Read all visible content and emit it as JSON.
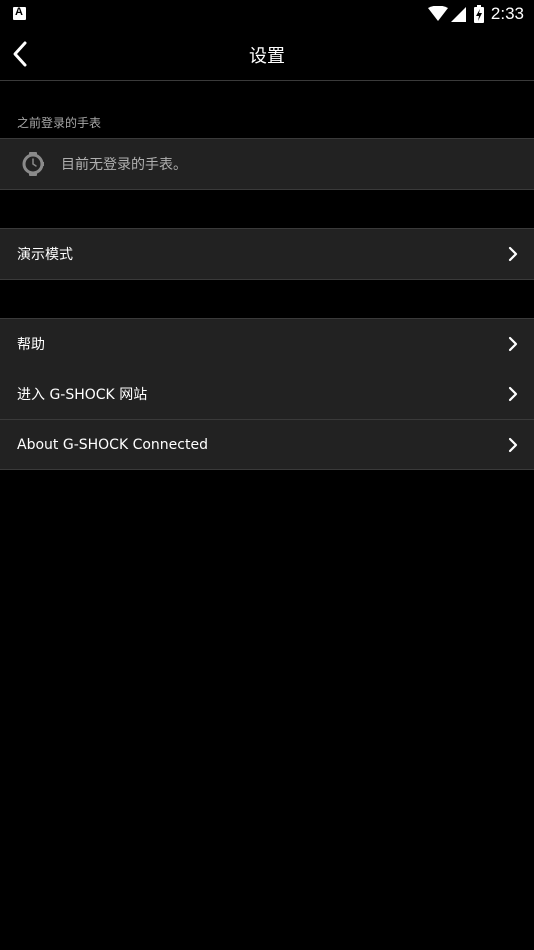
{
  "status_bar": {
    "time": "2:33"
  },
  "header": {
    "title": "设置"
  },
  "registered_watches": {
    "section_label": "之前登录的手表",
    "empty_message": "目前无登录的手表。"
  },
  "demo": {
    "label": "演示模式"
  },
  "links": [
    {
      "label": "帮助"
    },
    {
      "label": "进入 G-SHOCK 网站"
    },
    {
      "label": "About G-SHOCK Connected"
    }
  ]
}
